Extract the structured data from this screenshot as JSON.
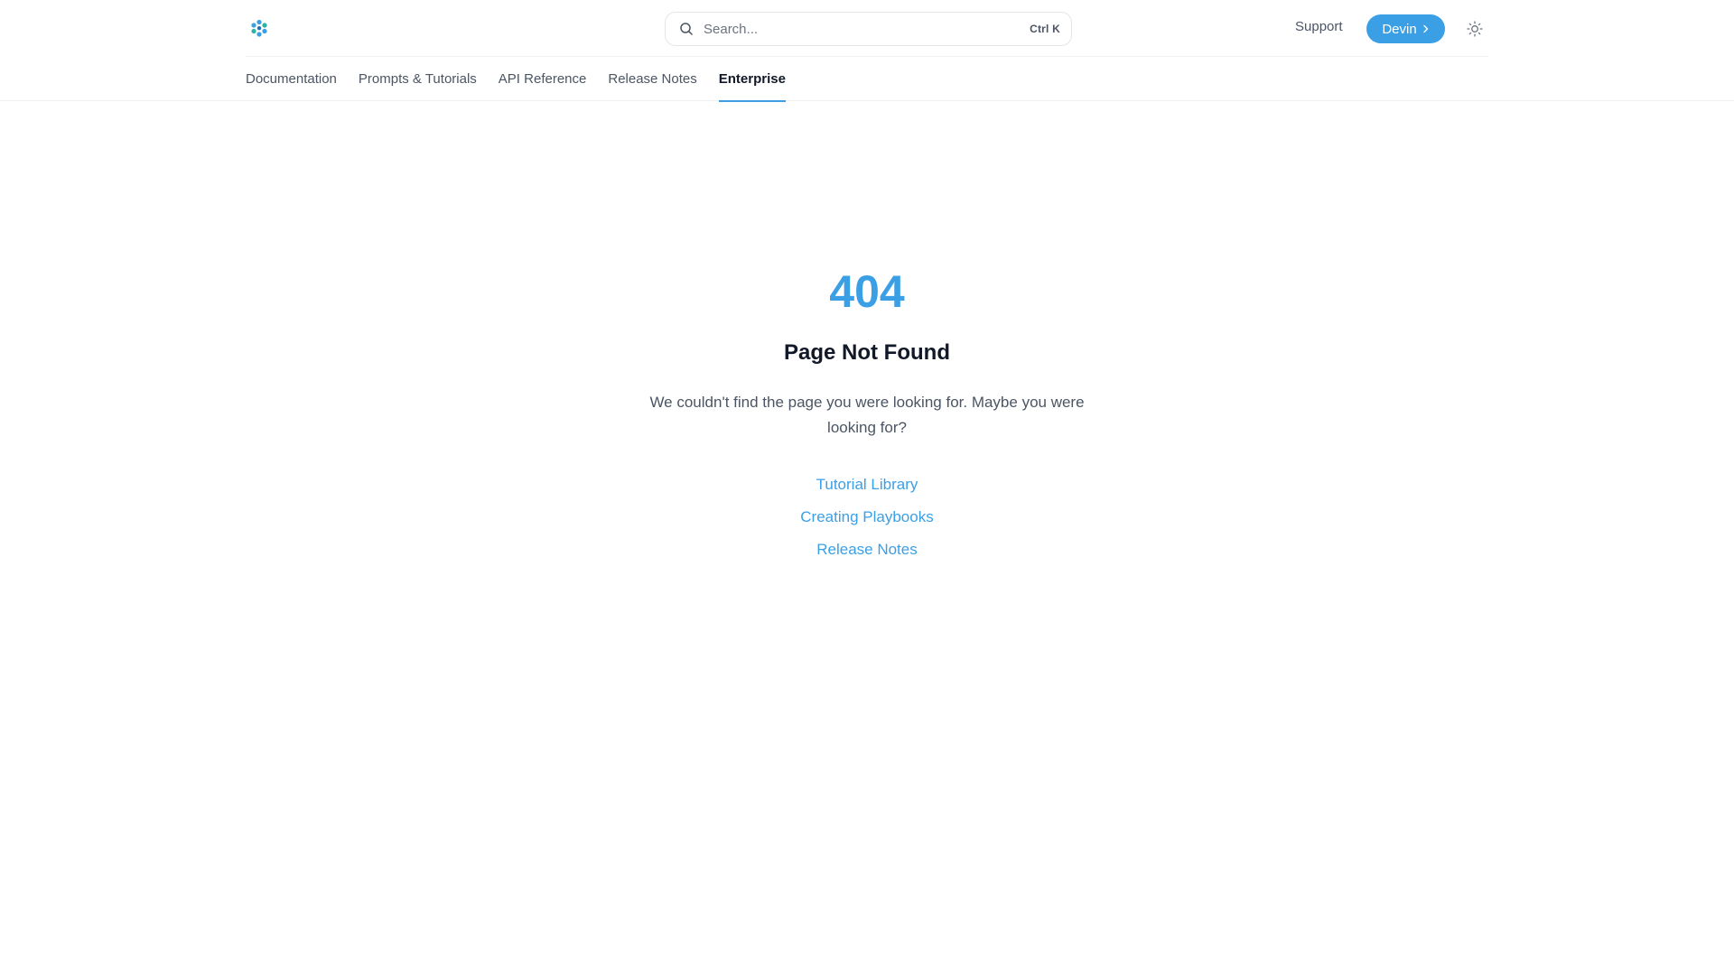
{
  "header": {
    "logo_icon": "devin-flower-logo",
    "search": {
      "placeholder": "Search...",
      "shortcut": "Ctrl K"
    },
    "support_label": "Support",
    "devin_button_label": "Devin",
    "devin_button_icon": "chevron-right-icon",
    "theme_icon": "sun-icon"
  },
  "tabs": [
    {
      "label": "Documentation",
      "active": false
    },
    {
      "label": "Prompts & Tutorials",
      "active": false
    },
    {
      "label": "API Reference",
      "active": false
    },
    {
      "label": "Release Notes",
      "active": false
    },
    {
      "label": "Enterprise",
      "active": true
    }
  ],
  "error": {
    "code": "404",
    "title": "Page Not Found",
    "description": "We couldn't find the page you were looking for. Maybe you were looking for?",
    "links": [
      {
        "label": "Tutorial Library"
      },
      {
        "label": "Creating Playbooks"
      },
      {
        "label": "Release Notes"
      }
    ]
  },
  "colors": {
    "accent": "#3b9fe6",
    "text_primary": "#111827",
    "text_secondary": "#4b5563",
    "border": "#e3e5e8"
  }
}
